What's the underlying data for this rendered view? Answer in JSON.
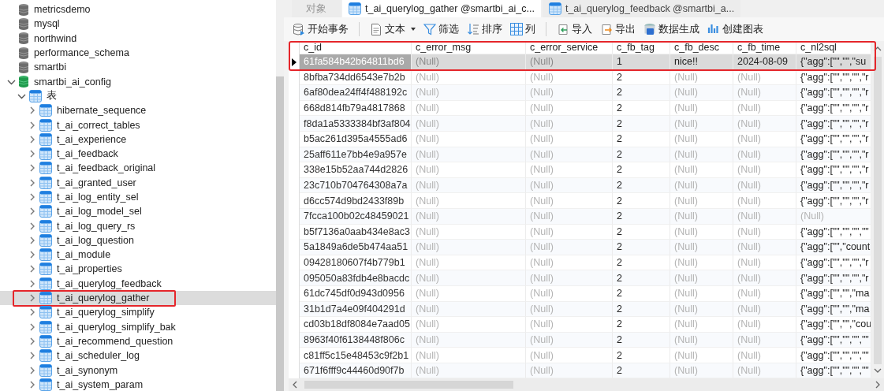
{
  "tree": [
    {
      "label": "metricsdemo",
      "kind": "database",
      "expanded": false
    },
    {
      "label": "mysql",
      "kind": "database",
      "expanded": false
    },
    {
      "label": "northwind",
      "kind": "database",
      "expanded": false
    },
    {
      "label": "performance_schema",
      "kind": "database",
      "expanded": false
    },
    {
      "label": "smartbi",
      "kind": "database",
      "expanded": false
    },
    {
      "label": "smartbi_ai_config",
      "kind": "database",
      "expanded": true,
      "children": [
        {
          "label": "表",
          "kind": "folder",
          "expanded": true,
          "children": [
            {
              "label": "hibernate_sequence",
              "kind": "table",
              "expanded": false,
              "selected": false,
              "highlighted": false
            },
            {
              "label": "t_ai_correct_tables",
              "kind": "table",
              "expanded": false,
              "selected": false,
              "highlighted": false
            },
            {
              "label": "t_ai_experience",
              "kind": "table",
              "expanded": false,
              "selected": false,
              "highlighted": false
            },
            {
              "label": "t_ai_feedback",
              "kind": "table",
              "expanded": false,
              "selected": false,
              "highlighted": false
            },
            {
              "label": "t_ai_feedback_original",
              "kind": "table",
              "expanded": false,
              "selected": false,
              "highlighted": false
            },
            {
              "label": "t_ai_granted_user",
              "kind": "table",
              "expanded": false,
              "selected": false,
              "highlighted": false
            },
            {
              "label": "t_ai_log_entity_sel",
              "kind": "table",
              "expanded": false,
              "selected": false,
              "highlighted": false
            },
            {
              "label": "t_ai_log_model_sel",
              "kind": "table",
              "expanded": false,
              "selected": false,
              "highlighted": false
            },
            {
              "label": "t_ai_log_query_rs",
              "kind": "table",
              "expanded": false,
              "selected": false,
              "highlighted": false
            },
            {
              "label": "t_ai_log_question",
              "kind": "table",
              "expanded": false,
              "selected": false,
              "highlighted": false
            },
            {
              "label": "t_ai_module",
              "kind": "table",
              "expanded": false,
              "selected": false,
              "highlighted": false
            },
            {
              "label": "t_ai_properties",
              "kind": "table",
              "expanded": false,
              "selected": false,
              "highlighted": false
            },
            {
              "label": "t_ai_querylog_feedback",
              "kind": "table",
              "expanded": false,
              "selected": false,
              "highlighted": false
            },
            {
              "label": "t_ai_querylog_gather",
              "kind": "table",
              "expanded": false,
              "selected": true,
              "highlighted": true
            },
            {
              "label": "t_ai_querylog_simplify",
              "kind": "table",
              "expanded": false,
              "selected": false,
              "highlighted": false
            },
            {
              "label": "t_ai_querylog_simplify_bak",
              "kind": "table",
              "expanded": false,
              "selected": false,
              "highlighted": false
            },
            {
              "label": "t_ai_recommend_question",
              "kind": "table",
              "expanded": false,
              "selected": false,
              "highlighted": false
            },
            {
              "label": "t_ai_scheduler_log",
              "kind": "table",
              "expanded": false,
              "selected": false,
              "highlighted": false
            },
            {
              "label": "t_ai_synonym",
              "kind": "table",
              "expanded": false,
              "selected": false,
              "highlighted": false
            },
            {
              "label": "t_ai_system_param",
              "kind": "table",
              "expanded": false,
              "selected": false,
              "highlighted": false
            }
          ]
        }
      ]
    }
  ],
  "tabs": [
    {
      "label": "对象",
      "kind": "objects",
      "selected": false
    },
    {
      "label": "t_ai_querylog_gather @smartbi_ai_c...",
      "kind": "table",
      "selected": true
    },
    {
      "label": "t_ai_querylog_feedback @smartbi_a...",
      "kind": "table",
      "selected": false
    }
  ],
  "toolbar": [
    {
      "label": "开始事务",
      "kind": "transaction"
    },
    {
      "kind": "separator"
    },
    {
      "label": "文本",
      "kind": "text",
      "dropdown": true
    },
    {
      "label": "筛选",
      "kind": "filter"
    },
    {
      "label": "排序",
      "kind": "sort"
    },
    {
      "label": "列",
      "kind": "columns"
    },
    {
      "kind": "separator"
    },
    {
      "label": "导入",
      "kind": "import"
    },
    {
      "label": "导出",
      "kind": "export"
    },
    {
      "label": "数据生成",
      "kind": "generate"
    },
    {
      "label": "创建图表",
      "kind": "chart"
    }
  ],
  "table": {
    "highlighted": true,
    "columns": [
      "c_id",
      "c_error_msg",
      "c_error_service",
      "c_fb_tag",
      "c_fb_desc",
      "c_fb_time",
      "c_nl2sql"
    ],
    "rows": [
      {
        "selected": true,
        "cells": [
          "61fa584b42b64811bd6",
          {
            "null": "(Null)"
          },
          {
            "null": "(Null)"
          },
          "1",
          "nice!!",
          "2024-08-09",
          "{\"agg\":[\"\",\"\",\"su"
        ]
      },
      {
        "selected": false,
        "cells": [
          "8bfba734dd6543e7b2b",
          {
            "null": "(Null)"
          },
          {
            "null": "(Null)"
          },
          "2",
          {
            "null": "(Null)"
          },
          {
            "null": "(Null)"
          },
          "{\"agg\":[\"\",\"\",\"\",\"r"
        ]
      },
      {
        "selected": false,
        "cells": [
          "6af80dea24ff4f488192c",
          {
            "null": "(Null)"
          },
          {
            "null": "(Null)"
          },
          "2",
          {
            "null": "(Null)"
          },
          {
            "null": "(Null)"
          },
          "{\"agg\":[\"\",\"\",\"\",\"r"
        ]
      },
      {
        "selected": false,
        "cells": [
          "668d814fb79a4817868",
          {
            "null": "(Null)"
          },
          {
            "null": "(Null)"
          },
          "2",
          {
            "null": "(Null)"
          },
          {
            "null": "(Null)"
          },
          "{\"agg\":[\"\",\"\",\"\",\"r"
        ]
      },
      {
        "selected": false,
        "cells": [
          "f8da1a5333384bf3af804",
          {
            "null": "(Null)"
          },
          {
            "null": "(Null)"
          },
          "2",
          {
            "null": "(Null)"
          },
          {
            "null": "(Null)"
          },
          "{\"agg\":[\"\",\"\",\"\",\"r"
        ]
      },
      {
        "selected": false,
        "cells": [
          "b5ac261d395a4555ad6",
          {
            "null": "(Null)"
          },
          {
            "null": "(Null)"
          },
          "2",
          {
            "null": "(Null)"
          },
          {
            "null": "(Null)"
          },
          "{\"agg\":[\"\",\"\",\"\",\"r"
        ]
      },
      {
        "selected": false,
        "cells": [
          "25aff611e7bb4e9a957e",
          {
            "null": "(Null)"
          },
          {
            "null": "(Null)"
          },
          "2",
          {
            "null": "(Null)"
          },
          {
            "null": "(Null)"
          },
          "{\"agg\":[\"\",\"\",\"\",\"r"
        ]
      },
      {
        "selected": false,
        "cells": [
          "338e15b52aa744d2826",
          {
            "null": "(Null)"
          },
          {
            "null": "(Null)"
          },
          "2",
          {
            "null": "(Null)"
          },
          {
            "null": "(Null)"
          },
          "{\"agg\":[\"\",\"\",\"\",\"r"
        ]
      },
      {
        "selected": false,
        "cells": [
          "23c710b704764308a7a",
          {
            "null": "(Null)"
          },
          {
            "null": "(Null)"
          },
          "2",
          {
            "null": "(Null)"
          },
          {
            "null": "(Null)"
          },
          "{\"agg\":[\"\",\"\",\"\",\"r"
        ]
      },
      {
        "selected": false,
        "cells": [
          "d6cc574d9bd2433f89b",
          {
            "null": "(Null)"
          },
          {
            "null": "(Null)"
          },
          "2",
          {
            "null": "(Null)"
          },
          {
            "null": "(Null)"
          },
          "{\"agg\":[\"\",\"\",\"\",\"r"
        ]
      },
      {
        "selected": false,
        "cells": [
          "7fcca100b02c48459021",
          {
            "null": "(Null)"
          },
          {
            "null": "(Null)"
          },
          "2",
          {
            "null": "(Null)"
          },
          {
            "null": "(Null)"
          },
          {
            "null": "(Null)"
          }
        ]
      },
      {
        "selected": false,
        "cells": [
          "b5f7136a0aab434e8ac3",
          {
            "null": "(Null)"
          },
          {
            "null": "(Null)"
          },
          "2",
          {
            "null": "(Null)"
          },
          {
            "null": "(Null)"
          },
          "{\"agg\":[\"\",\"\",\"\",\"\""
        ]
      },
      {
        "selected": false,
        "cells": [
          "5a1849a6de5b474aa51",
          {
            "null": "(Null)"
          },
          {
            "null": "(Null)"
          },
          "2",
          {
            "null": "(Null)"
          },
          {
            "null": "(Null)"
          },
          "{\"agg\":[\"\",\"count"
        ]
      },
      {
        "selected": false,
        "cells": [
          "09428180607f4b779b1",
          {
            "null": "(Null)"
          },
          {
            "null": "(Null)"
          },
          "2",
          {
            "null": "(Null)"
          },
          {
            "null": "(Null)"
          },
          "{\"agg\":[\"\",\"\",\"\",\"r"
        ]
      },
      {
        "selected": false,
        "cells": [
          "095050a83fdb4e8bacdc",
          {
            "null": "(Null)"
          },
          {
            "null": "(Null)"
          },
          "2",
          {
            "null": "(Null)"
          },
          {
            "null": "(Null)"
          },
          "{\"agg\":[\"\",\"\",\"\",\"r"
        ]
      },
      {
        "selected": false,
        "cells": [
          "61dc745df0d943d0956",
          {
            "null": "(Null)"
          },
          {
            "null": "(Null)"
          },
          "2",
          {
            "null": "(Null)"
          },
          {
            "null": "(Null)"
          },
          "{\"agg\":[\"\",\"\",\"ma"
        ]
      },
      {
        "selected": false,
        "cells": [
          "31b1d7a4e09f404291d",
          {
            "null": "(Null)"
          },
          {
            "null": "(Null)"
          },
          "2",
          {
            "null": "(Null)"
          },
          {
            "null": "(Null)"
          },
          "{\"agg\":[\"\",\"\",\"ma"
        ]
      },
      {
        "selected": false,
        "cells": [
          "cd03b18df8084e7aad05",
          {
            "null": "(Null)"
          },
          {
            "null": "(Null)"
          },
          "2",
          {
            "null": "(Null)"
          },
          {
            "null": "(Null)"
          },
          "{\"agg\":[\"\",\"\",\"cou"
        ]
      },
      {
        "selected": false,
        "cells": [
          "8963f40f6138448f806c",
          {
            "null": "(Null)"
          },
          {
            "null": "(Null)"
          },
          "2",
          {
            "null": "(Null)"
          },
          {
            "null": "(Null)"
          },
          "{\"agg\":[\"\",\"\",\"\",\"\""
        ]
      },
      {
        "selected": false,
        "cells": [
          "c81ff5c15e48453c9f2b1",
          {
            "null": "(Null)"
          },
          {
            "null": "(Null)"
          },
          "2",
          {
            "null": "(Null)"
          },
          {
            "null": "(Null)"
          },
          "{\"agg\":[\"\",\"\",\"\",\"\""
        ]
      },
      {
        "selected": false,
        "cells": [
          "671f6fff9c44460d90f7b",
          {
            "null": "(Null)"
          },
          {
            "null": "(Null)"
          },
          "2",
          {
            "null": "(Null)"
          },
          {
            "null": "(Null)"
          },
          "{\"agg\":[\"\",\"\",\"\",\"\""
        ]
      }
    ]
  }
}
